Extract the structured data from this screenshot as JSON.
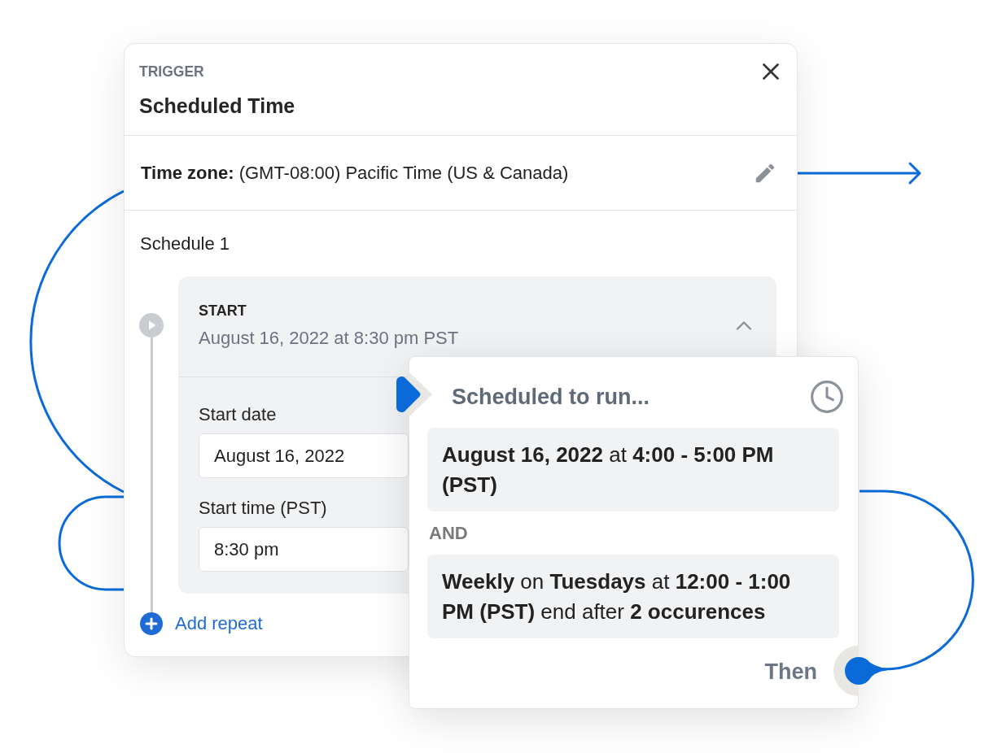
{
  "trigger_card": {
    "eyebrow": "TRIGGER",
    "title": "Scheduled Time",
    "time_zone": "**Time zone:** (GMT-08:00) Pacific Time (US & Canada)",
    "schedule": {
      "title": "Schedule 1",
      "start": {
        "heading": "START",
        "summary": "August 16, 2022 at 8:30 pm PST",
        "expanded": true,
        "fields": [
          {
            "label": "Start date",
            "value": "August 16, 2022"
          },
          {
            "label": "Start time (PST)",
            "value": "8:30 pm"
          }
        ]
      },
      "add_repeat": "Add repeat"
    }
  },
  "run_card": {
    "title": "Scheduled to run...",
    "conditions": [
      "**August 16, 2022** at **4:00 - 5:00 PM (PST)**",
      "**Weekly** on **Tuesdays** at **12:00 - 1:00 PM (PST)** end after **2 occurences**"
    ],
    "joiner": "AND",
    "then": "Then"
  }
}
